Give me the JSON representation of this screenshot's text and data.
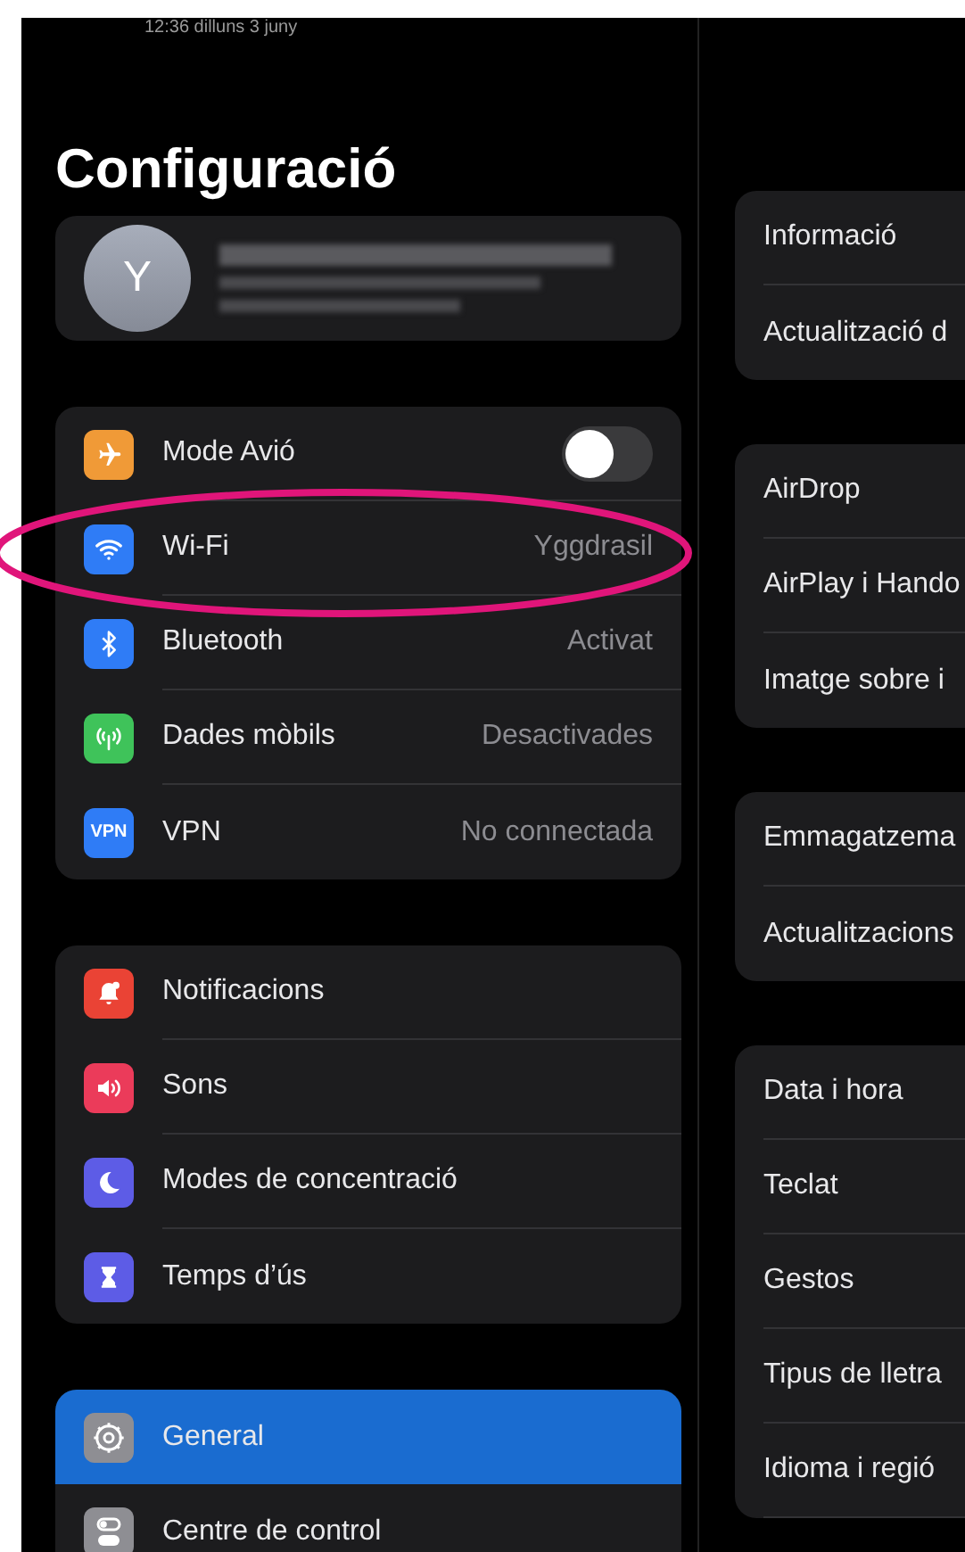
{
  "status_bar": {
    "text": "12:36  dilluns 3 juny"
  },
  "title": "Configuració",
  "profile": {
    "initial": "Y"
  },
  "sidebar": {
    "groups": [
      {
        "items": [
          {
            "label": "Mode Avió",
            "color": "#f09a37",
            "kind": "toggle",
            "on": false,
            "selected": false
          },
          {
            "label": "Wi-Fi",
            "color": "#2f7cf6",
            "kind": "value",
            "value": "Yggdrasil",
            "selected": false
          },
          {
            "label": "Bluetooth",
            "color": "#2f7cf6",
            "kind": "value",
            "value": "Activat",
            "selected": false
          },
          {
            "label": "Dades mòbils",
            "color": "#3fc35a",
            "kind": "value",
            "value": "Desactivades",
            "selected": false
          },
          {
            "label": "VPN",
            "icon_text": "VPN",
            "color": "#2f7cf6",
            "kind": "value",
            "value": "No connectada",
            "selected": false
          }
        ]
      },
      {
        "items": [
          {
            "label": "Notificacions",
            "color": "#ea4335",
            "kind": "plain",
            "selected": false
          },
          {
            "label": "Sons",
            "color": "#eb3b5a",
            "kind": "plain",
            "selected": false
          },
          {
            "label": "Modes de concentració",
            "color": "#5d5ce6",
            "kind": "plain",
            "selected": false
          },
          {
            "label": "Temps d’ús",
            "color": "#5d5ce6",
            "kind": "plain",
            "selected": false
          }
        ]
      },
      {
        "items": [
          {
            "label": "General",
            "color": "#8e8e93",
            "kind": "plain",
            "selected": true
          },
          {
            "label": "Centre de control",
            "color": "#8e8e93",
            "kind": "plain",
            "selected": false
          }
        ]
      }
    ]
  },
  "detail": {
    "groups": [
      [
        "Informació",
        "Actualització d"
      ],
      [
        "AirDrop",
        "AirPlay i Hando",
        "Imatge sobre i"
      ],
      [
        "Emmagatzema",
        "Actualitzacions"
      ],
      [
        "Data i hora",
        "Teclat",
        "Gestos",
        "Tipus de lletra",
        "Idioma i regió"
      ]
    ]
  }
}
